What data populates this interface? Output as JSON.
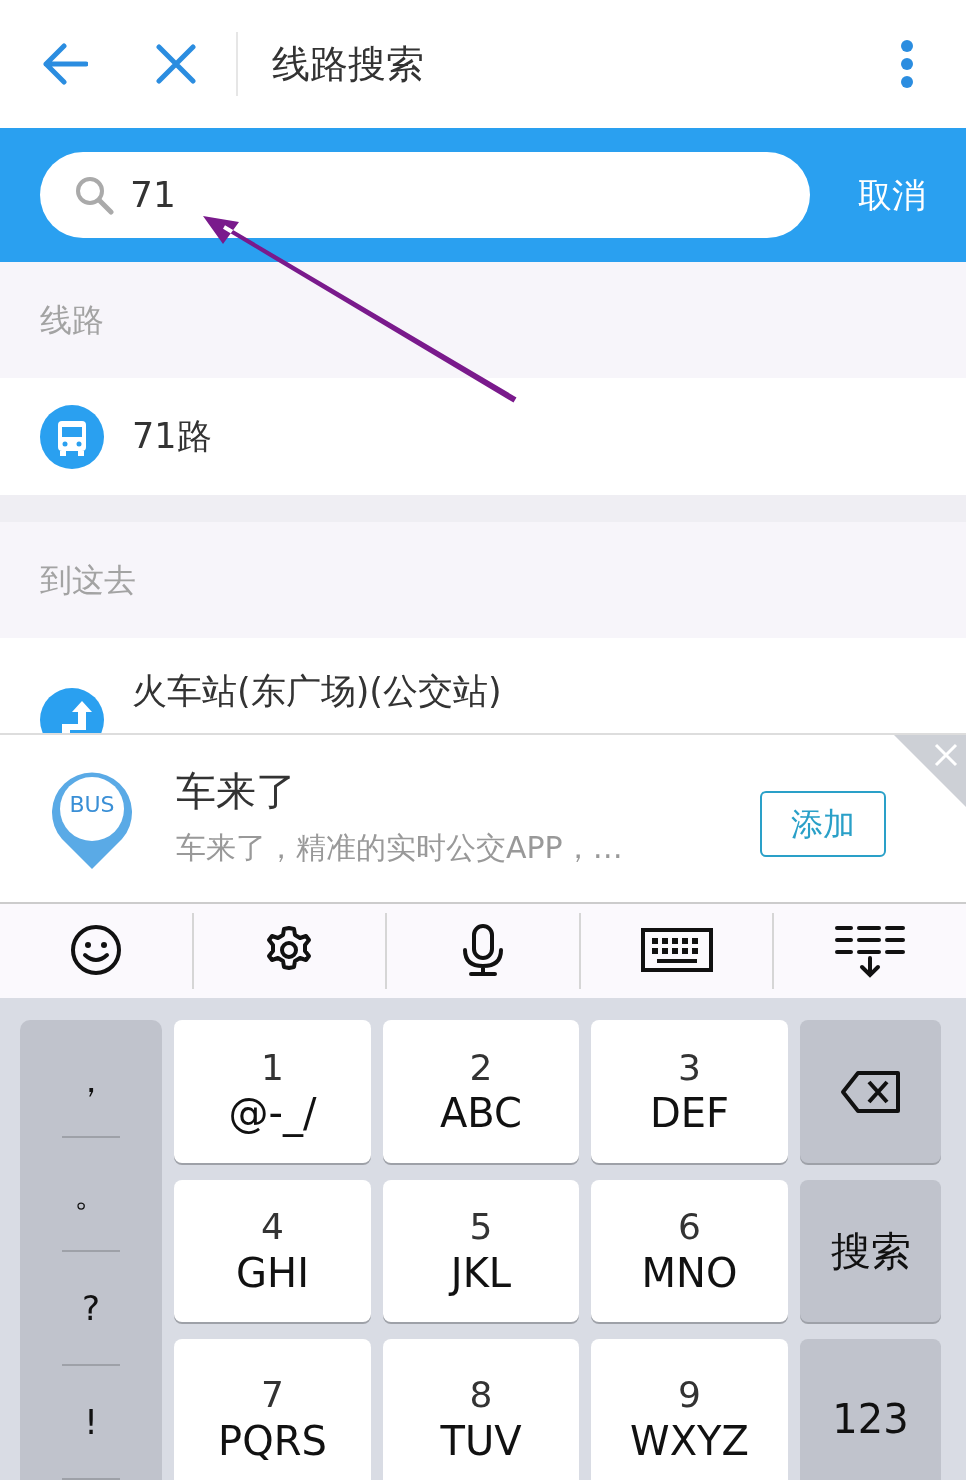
{
  "header": {
    "title": "线路搜索"
  },
  "search": {
    "value": "71",
    "cancel": "取消"
  },
  "sections": [
    {
      "title": "线路",
      "items": [
        {
          "kind": "route",
          "name": "71路"
        }
      ]
    },
    {
      "title": "到这去",
      "items": [
        {
          "kind": "place",
          "name": "火车站(东广场)(公交站)"
        }
      ]
    }
  ],
  "banner": {
    "logo_text": "BUS",
    "app_name": "车来了",
    "description": "车来了，精准的实时公交APP，…",
    "button": "添加"
  },
  "keyboard": {
    "punctuation": [
      "，",
      "。",
      "?",
      "!"
    ],
    "keys": [
      {
        "digit": "1",
        "letters": "@-_/"
      },
      {
        "digit": "2",
        "letters": "ABC"
      },
      {
        "digit": "3",
        "letters": "DEF"
      },
      {
        "digit": "4",
        "letters": "GHI"
      },
      {
        "digit": "5",
        "letters": "JKL"
      },
      {
        "digit": "6",
        "letters": "MNO"
      },
      {
        "digit": "7",
        "letters": "PQRS"
      },
      {
        "digit": "8",
        "letters": "TUV"
      },
      {
        "digit": "9",
        "letters": "WXYZ"
      }
    ],
    "search_key": "搜索",
    "mode_key": "123"
  }
}
